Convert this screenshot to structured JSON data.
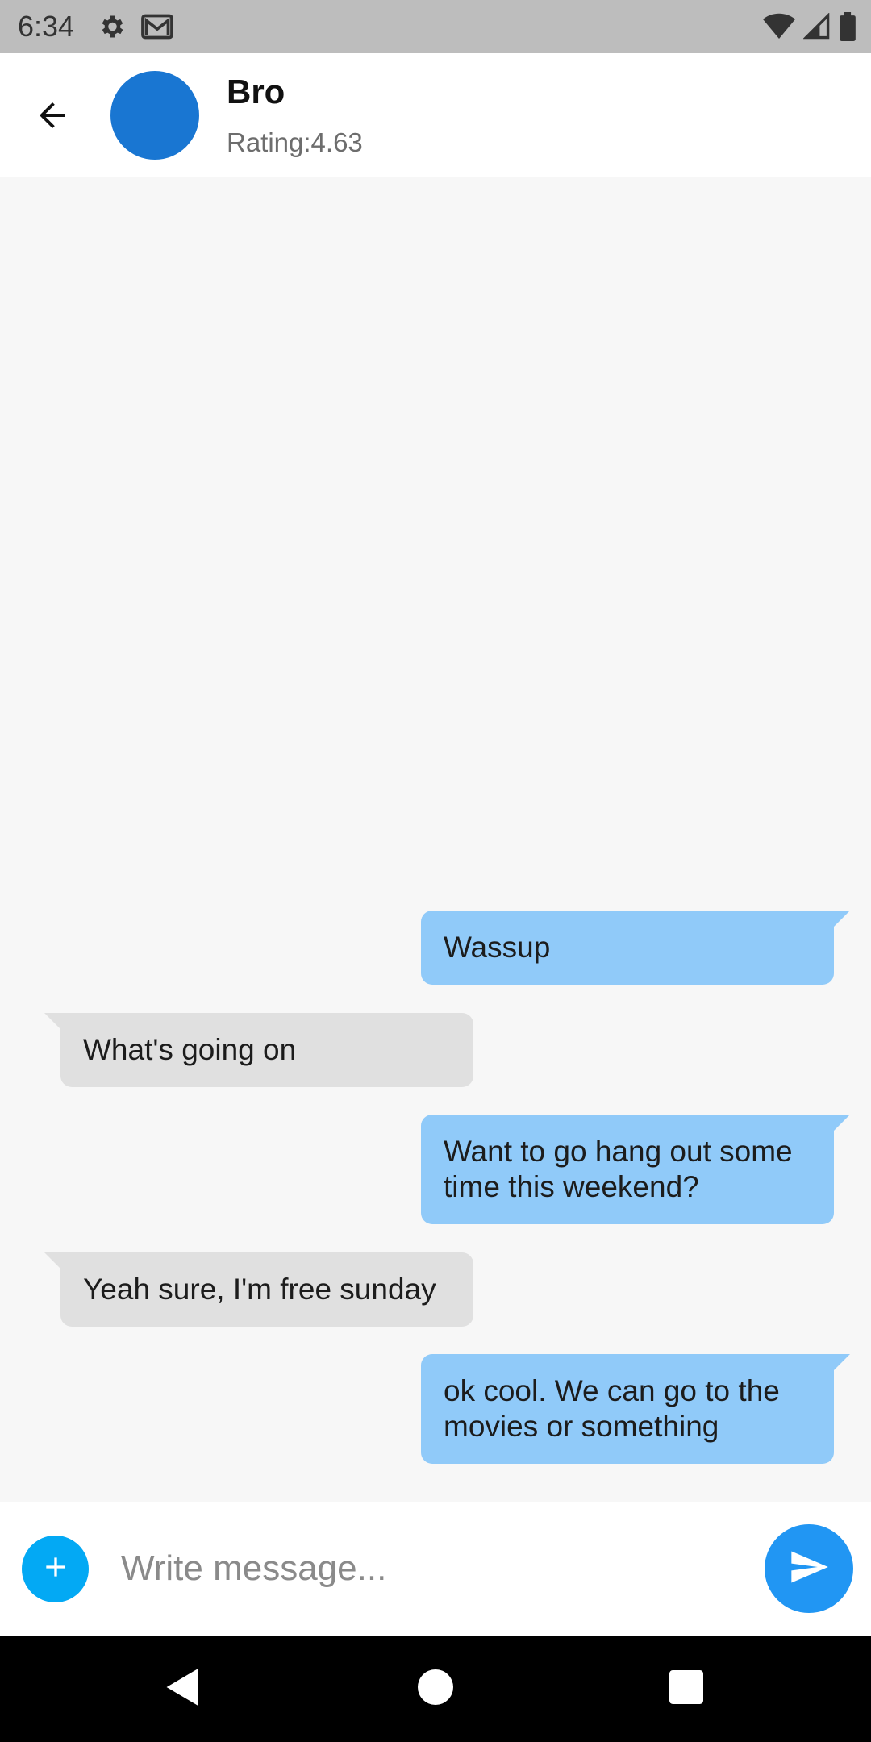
{
  "status_bar": {
    "time": "6:34",
    "icons_left": [
      "settings-icon",
      "gmail-icon"
    ],
    "icons_right": [
      "wifi-icon",
      "signal-icon",
      "battery-icon"
    ]
  },
  "header": {
    "back_icon": "arrow-back-icon",
    "name": "Bro",
    "rating": "Rating:4.63",
    "avatar_color": "#1976d2"
  },
  "messages": [
    {
      "direction": "outgoing",
      "text": "Wassup"
    },
    {
      "direction": "incoming",
      "text": "What's going on"
    },
    {
      "direction": "outgoing",
      "text": "Want to go hang out some time this weekend?"
    },
    {
      "direction": "incoming",
      "text": "Yeah sure, I'm free sunday"
    },
    {
      "direction": "outgoing",
      "text": "ok cool. We can go to the movies or something"
    }
  ],
  "composer": {
    "add_icon": "plus-icon",
    "placeholder": "Write message...",
    "value": "",
    "send_icon": "send-icon"
  },
  "colors": {
    "outgoing_bubble": "#90caf9",
    "incoming_bubble": "#e0e0e0",
    "add_button": "#03a9f4",
    "send_button": "#2196f3"
  }
}
